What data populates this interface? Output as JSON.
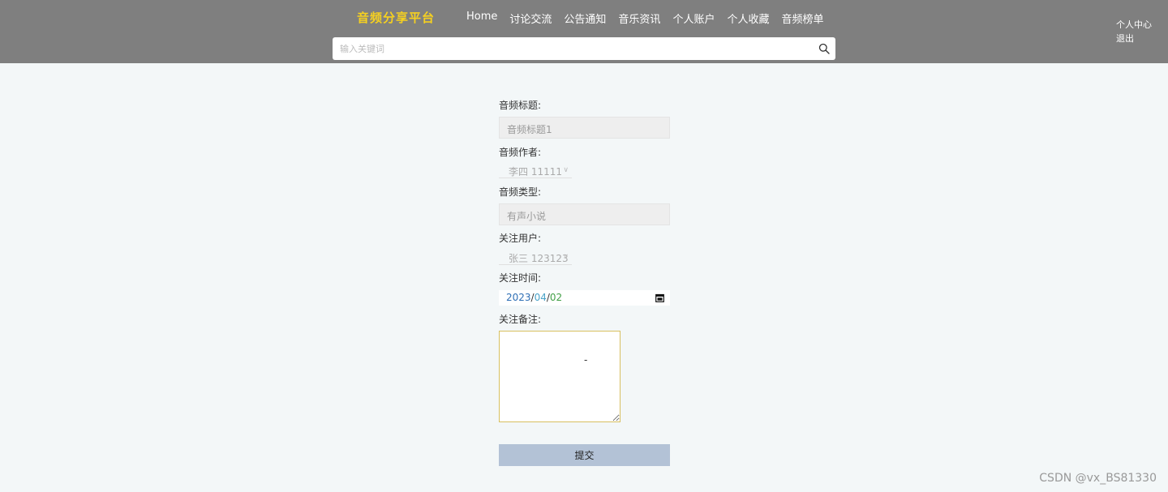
{
  "header": {
    "brand": "音频分享平台",
    "nav": [
      "Home",
      "讨论交流",
      "公告通知",
      "音乐资讯",
      "个人账户",
      "个人收藏",
      "音频榜单"
    ],
    "user_menu": [
      "个人中心",
      "退出"
    ],
    "search_placeholder": "输入关键词"
  },
  "form": {
    "title_label": "音频标题:",
    "title_value": "音频标题1",
    "author_label": "音频作者:",
    "author_value": "李四 11111",
    "type_label": "音频类型:",
    "type_value": "有声小说",
    "user_label": "关注用户:",
    "user_value": "张三 123123",
    "time_label": "关注时间:",
    "date_year": "2023",
    "date_month": "04",
    "date_day": "02",
    "date_sep": "/",
    "note_label": "关注备注:",
    "note_value": "-",
    "submit_label": "提交"
  },
  "watermark": "CSDN @vx_BS81330",
  "colors": {
    "header_bg": "#7f7f7f",
    "brand": "#f5d020",
    "submit_bg": "#b3c2d6",
    "page_bg": "#f3f7f8"
  }
}
